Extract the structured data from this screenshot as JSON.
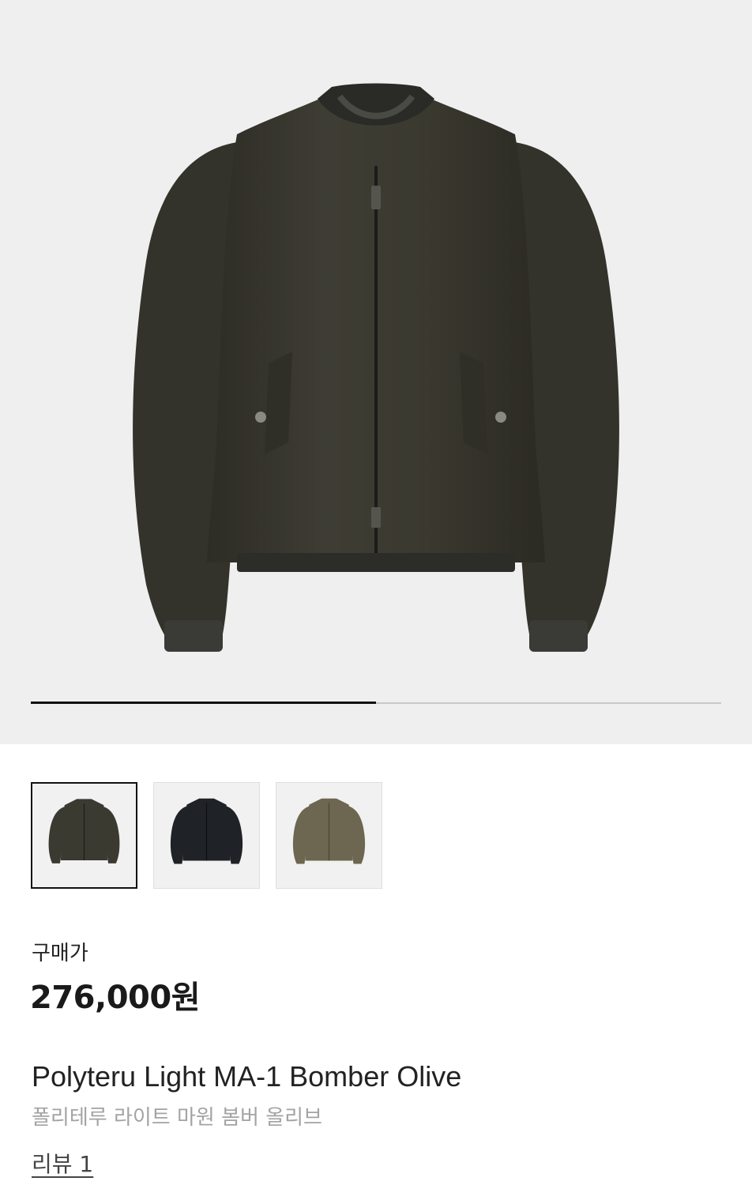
{
  "gallery": {
    "main_image": "olive-ma1-bomber-jacket-photo",
    "slide_progress": 0.5
  },
  "thumbnails": [
    {
      "color": "olive",
      "image": "olive-jacket-thumbnail",
      "selected": true
    },
    {
      "color": "black",
      "image": "black-jacket-thumbnail",
      "selected": false
    },
    {
      "color": "khaki",
      "image": "khaki-jacket-thumbnail",
      "selected": false
    }
  ],
  "product": {
    "price_label": "구매가",
    "price": "276,000원",
    "name_en": "Polyteru Light MA-1 Bomber Olive",
    "name_ko": "폴리테루 라이트 마원 봄버 올리브",
    "reviews_label": "리뷰 1"
  },
  "colors": {
    "hero_bg": "#efefef",
    "jacket_olive": "#3b3a31",
    "jacket_black": "#1f2226",
    "jacket_khaki": "#6d6650",
    "accent_text": "#1a1a1a",
    "muted_text": "#a3a3a3"
  }
}
